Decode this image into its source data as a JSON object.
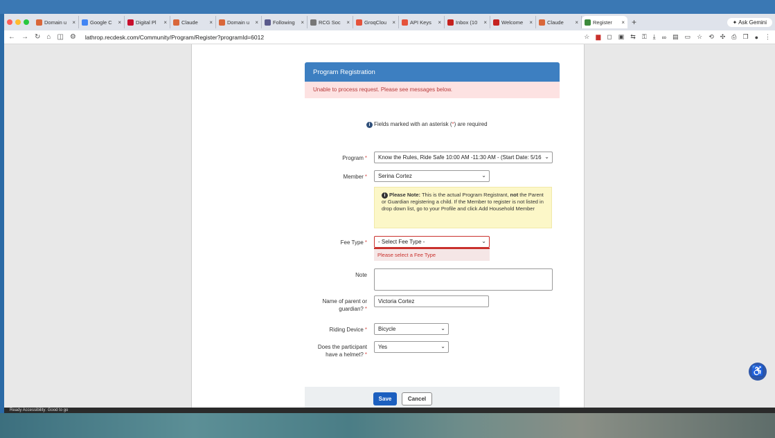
{
  "browser": {
    "tabs": [
      {
        "title": "Domain u",
        "favicon": "asterisk-icon",
        "color": "#d9673a"
      },
      {
        "title": "Google C",
        "favicon": "sparkle-icon",
        "color": "#4285f4"
      },
      {
        "title": "Digital Pl",
        "favicon": "circle-icon",
        "color": "#c8102e"
      },
      {
        "title": "Claude",
        "favicon": "asterisk-icon",
        "color": "#d9673a"
      },
      {
        "title": "Domain u",
        "favicon": "asterisk-icon",
        "color": "#d9673a"
      },
      {
        "title": "Following",
        "favicon": "m-icon",
        "color": "#5a5a8c"
      },
      {
        "title": "RCG Soc",
        "favicon": "globe-icon",
        "color": "#777777"
      },
      {
        "title": "GroqClou",
        "favicon": "g-icon",
        "color": "#e5533b"
      },
      {
        "title": "API Keys",
        "favicon": "g-icon",
        "color": "#e5533b"
      },
      {
        "title": "Inbox (10",
        "favicon": "gmail-icon",
        "color": "#c5221f"
      },
      {
        "title": "Welcome",
        "favicon": "gmail-icon",
        "color": "#c5221f"
      },
      {
        "title": "Claude",
        "favicon": "asterisk-icon",
        "color": "#d9673a"
      },
      {
        "title": "Register",
        "favicon": "rec-icon",
        "color": "#3d8b3d",
        "active": true
      }
    ],
    "new_tab": "+",
    "ask_gemini": "Ask Gemini",
    "url": "lathrop.recdesk.com/Community/Program/Register?programId=6012"
  },
  "form": {
    "header": "Program Registration",
    "error_message": "Unable to process request. Please see messages below.",
    "required_note_pre": "Fields marked with an asterisk (",
    "required_note_star": "*",
    "required_note_post": ") are required",
    "star": "*",
    "program": {
      "label": "Program",
      "value": "Know the Rules, Ride Safe 10:00 AM -11:30 AM - (Start Date: 5/16"
    },
    "member": {
      "label": "Member",
      "value": "Serina Cortez"
    },
    "notice": {
      "bold1": "Please Note:",
      "text1": " This is the actual Program Registrant, ",
      "bold2": "not",
      "text2": " the Parent or Guardian registering a child. If the Member to register is not listed in drop down list, go to your Profile and click Add Household Member"
    },
    "fee_type": {
      "label": "Fee Type",
      "value": "- Select Fee Type -",
      "error": "Please select a Fee Type"
    },
    "note": {
      "label": "Note"
    },
    "guardian": {
      "label": "Name of parent or guardian?",
      "value": "Victoria Cortez"
    },
    "riding_device": {
      "label": "Riding Device",
      "value": "Bicycle"
    },
    "helmet": {
      "label": "Does the participant have a helmet?",
      "value": "Yes"
    },
    "save": "Save",
    "cancel": "Cancel"
  },
  "statusbar": "Ready   Accessibility: Good to go"
}
